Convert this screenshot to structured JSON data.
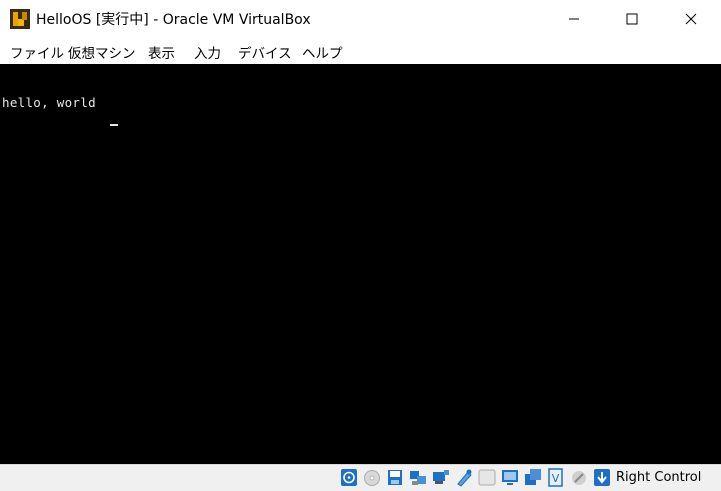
{
  "window": {
    "title": "HelloOS [実行中] - Oracle VM VirtualBox"
  },
  "menu": {
    "items": [
      "ファイル",
      "仮想マシン",
      "表示",
      "入力",
      "デバイス",
      "ヘルプ"
    ]
  },
  "console": {
    "text": "hello, world"
  },
  "statusbar": {
    "icons": [
      "optical-drive-icon",
      "disk-icon",
      "audio-icon",
      "network-icon",
      "usb-icon",
      "shared-folder-icon",
      "display-icon",
      "video-capture-icon",
      "virtualization-icon",
      "mouse-integration-icon",
      "keyboard-icon"
    ],
    "host_key": "Right Control"
  },
  "colors": {
    "screen": "#000000",
    "console_text": "#e8e8e8",
    "icon_blue": "#1e6fc8"
  }
}
